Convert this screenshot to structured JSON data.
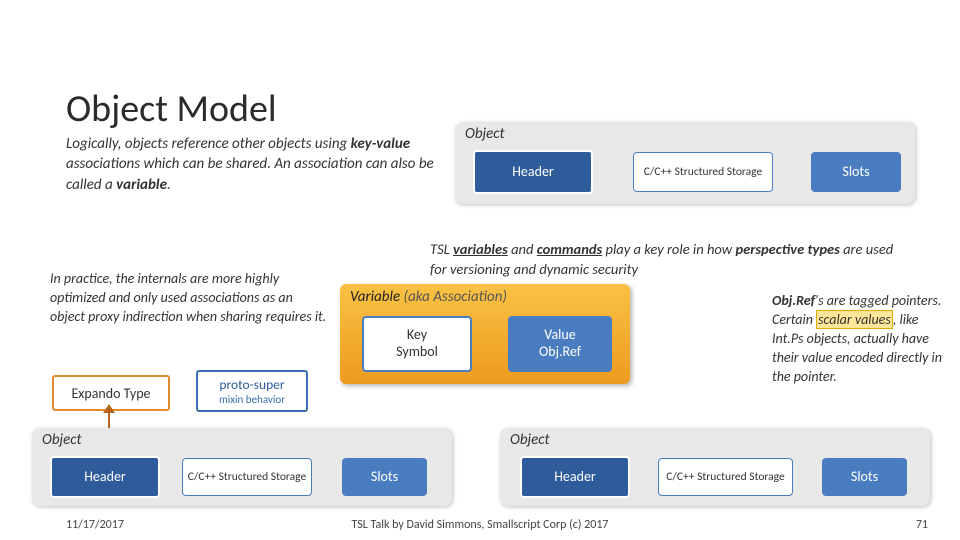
{
  "title": "Object Model",
  "para1_html": "Logically, objects reference other objects using <b>key-value</b> associations which can be shared. An association can also be called a <b>variable</b>.",
  "para2": "In practice, the internals are more highly optimized and only used associations as an object proxy indirection when sharing requires it.",
  "tsltext_html": "TSL <b class='uline'>variables</b> and <b class='uline'>commands</b> play a key role in how <b>perspective types</b> are used for versioning and dynamic security",
  "objref_html": "<b>Obj.Ref</b>'s are tagged pointers. Certain <span class='hl'>scalar values</span>, like Int.Ps objects, actually have their value encoded directly in the pointer.",
  "object_label": "Object",
  "header_label": "Header",
  "storage_label": "C/C++ Structured Storage",
  "slots_label": "Slots",
  "variable_label": "Variable",
  "variable_sub": "(aka Association)",
  "key_l1": "Key",
  "key_l2": "Symbol",
  "value_l1": "Value",
  "value_l2": "Obj.Ref",
  "expando_label": "Expando Type",
  "proto_l1": "proto-super",
  "proto_l2": "mixin behavior",
  "footer_date": "11/17/2017",
  "footer_center": "TSL Talk by David Simmons, Smallscript Corp (c) 2017",
  "footer_page": "71"
}
